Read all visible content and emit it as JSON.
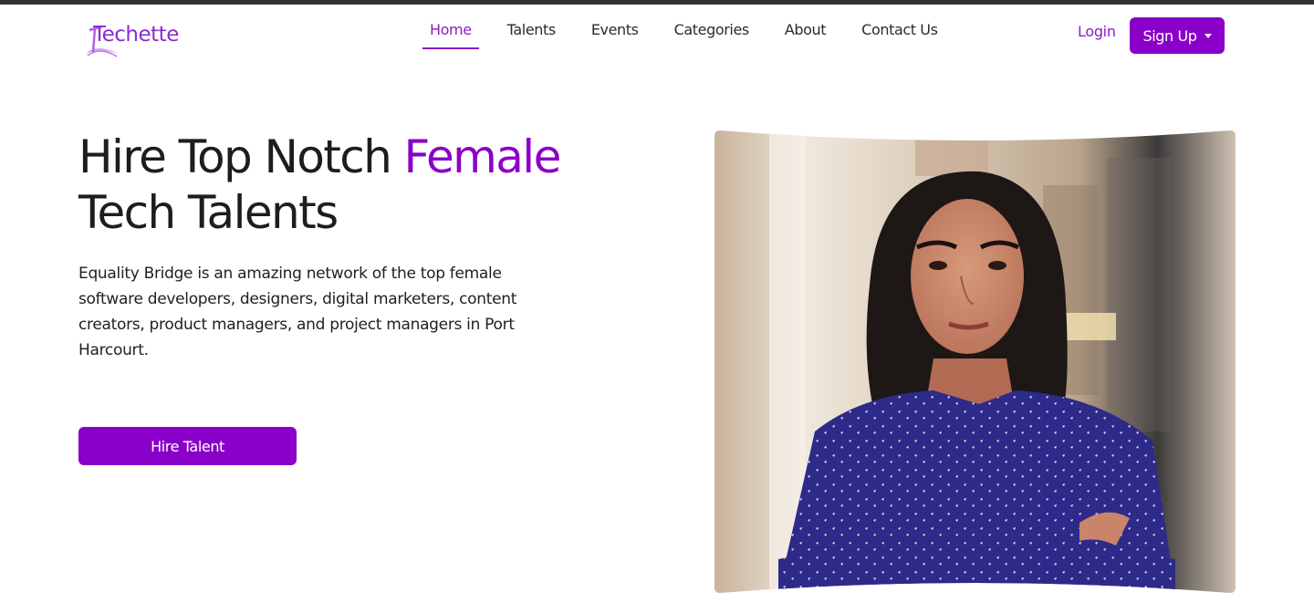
{
  "brand": {
    "name": "Techette"
  },
  "nav": {
    "items": [
      {
        "label": "Home",
        "active": true
      },
      {
        "label": "Talents",
        "active": false
      },
      {
        "label": "Events",
        "active": false
      },
      {
        "label": "Categories",
        "active": false
      },
      {
        "label": "About",
        "active": false
      },
      {
        "label": "Contact Us",
        "active": false
      }
    ],
    "login_label": "Login",
    "signup_label": "Sign Up"
  },
  "hero": {
    "title_part1": "Hire Top Notch ",
    "title_accent": "Female",
    "title_part2": "Tech Talents",
    "description": "Equality Bridge is an amazing network of the top female software developers, designers, digital marketers, content creators, product managers, and project managers in Port Harcourt.",
    "cta_label": "Hire Talent"
  },
  "colors": {
    "accent": "#8a00c9",
    "text": "#1f1f1f",
    "topbar": "#333333"
  }
}
